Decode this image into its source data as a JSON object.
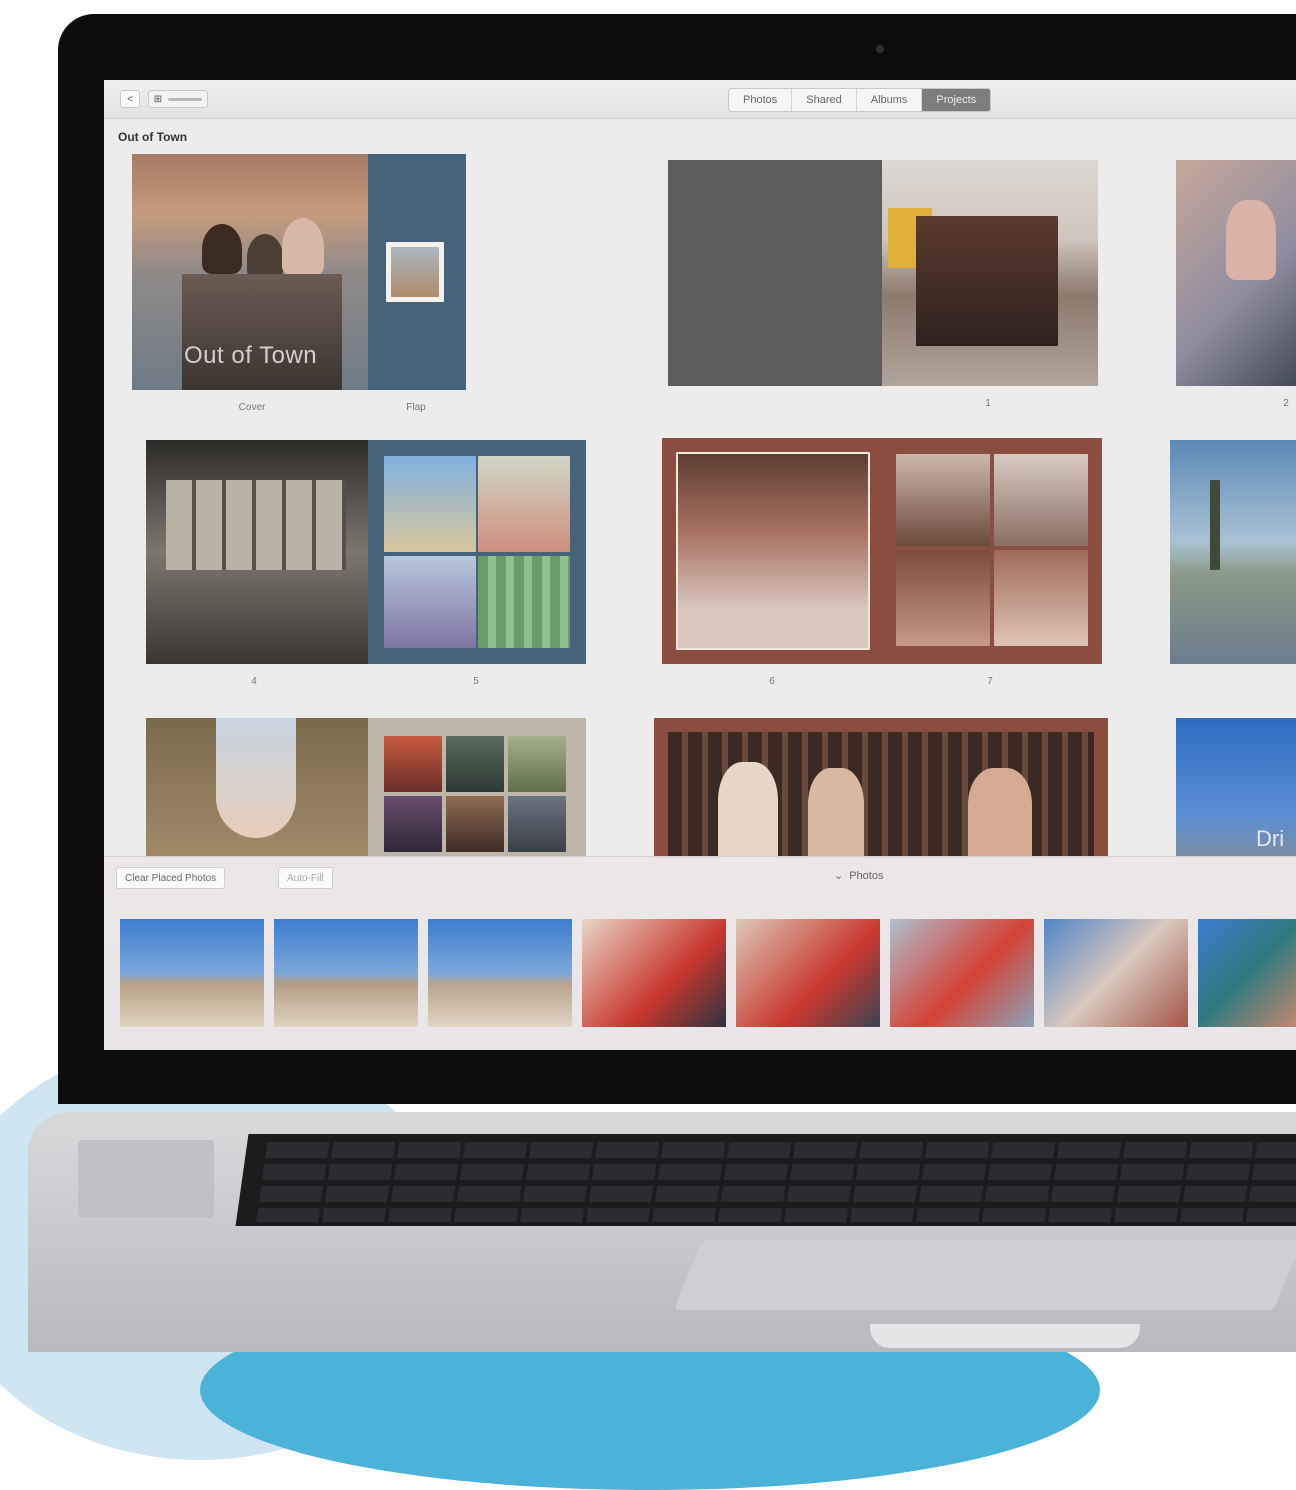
{
  "toolbar": {
    "back_label": "<",
    "view_label": "⊞",
    "tabs": [
      {
        "label": "Photos"
      },
      {
        "label": "Shared"
      },
      {
        "label": "Albums"
      },
      {
        "label": "Projects"
      }
    ],
    "active_tab": "Projects"
  },
  "project": {
    "title": "Out of Town",
    "cover_text": "Out of Town"
  },
  "spreads": [
    {
      "left_label": "Cover",
      "right_label": "Flap"
    },
    {
      "right_label": "1"
    },
    {
      "right_label": "2"
    },
    {
      "left_label": "4",
      "right_label": "5"
    },
    {
      "left_label": "6",
      "right_label": "7"
    },
    {
      "right_text": "Dri"
    }
  ],
  "drawer": {
    "clear_button": "Clear Placed Photos",
    "autofill_button": "Auto-Fill",
    "toggle_label": "Photos"
  },
  "colors": {
    "slate_blue": "#47627b",
    "brown_frame": "#8a4d3f",
    "dark_grey_page": "#5c5b5d",
    "taupe_page": "#bdb6a9",
    "active_tab": "#7d7d7d"
  }
}
